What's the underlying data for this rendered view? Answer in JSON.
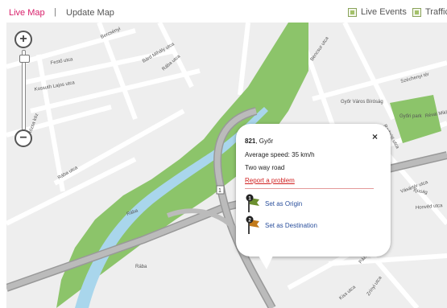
{
  "tabs": {
    "live_map": "Live Map",
    "separator": "|",
    "update_map": "Update Map"
  },
  "toggles": {
    "live_events": "Live Events",
    "traffic": "Traffic"
  },
  "zoom": {
    "in_symbol": "+",
    "out_symbol": "−",
    "level_fraction": 0.05
  },
  "map": {
    "street_labels": [
      "Bercsényi",
      "Festő utca",
      "Bárd Mihály utca",
      "Rába utca",
      "Kossuth Lajos utca",
      "Rózsa köz",
      "Rába utca",
      "Bencsur utca",
      "Győr Város Bíróság",
      "Széchenyi tér",
      "Radnóti utca",
      "Győri park",
      "Révai Miklós",
      "Ifjúság",
      "Rába",
      "Vásártér utca",
      "Honvéd utca",
      "Kiss utca",
      "Zrínyi utca",
      "Pázmány",
      "Rába"
    ],
    "road_shield": "1"
  },
  "popup": {
    "road_number": "821",
    "city": ", Győr",
    "speed": "Average speed: 35  km/h",
    "road_type": "Two way road",
    "report": "Report a problem",
    "close": "×",
    "origin": "Set as Origin",
    "origin_marker": "1",
    "destination": "Set as Destination",
    "destination_marker": "2"
  },
  "colors": {
    "accent": "#d81f6a",
    "park_green": "#8cc46a",
    "river": "#a9d6ec",
    "map_background": "#eeeeee",
    "road_gray": "#aaaaaa",
    "link_blue": "#2a4f9c",
    "report_red": "#d02020"
  },
  "icons": {
    "zoom_in": "plus-circle-icon",
    "zoom_out": "minus-circle-icon",
    "origin": "flag-origin-icon",
    "destination": "flag-destination-icon",
    "close": "close-icon"
  }
}
